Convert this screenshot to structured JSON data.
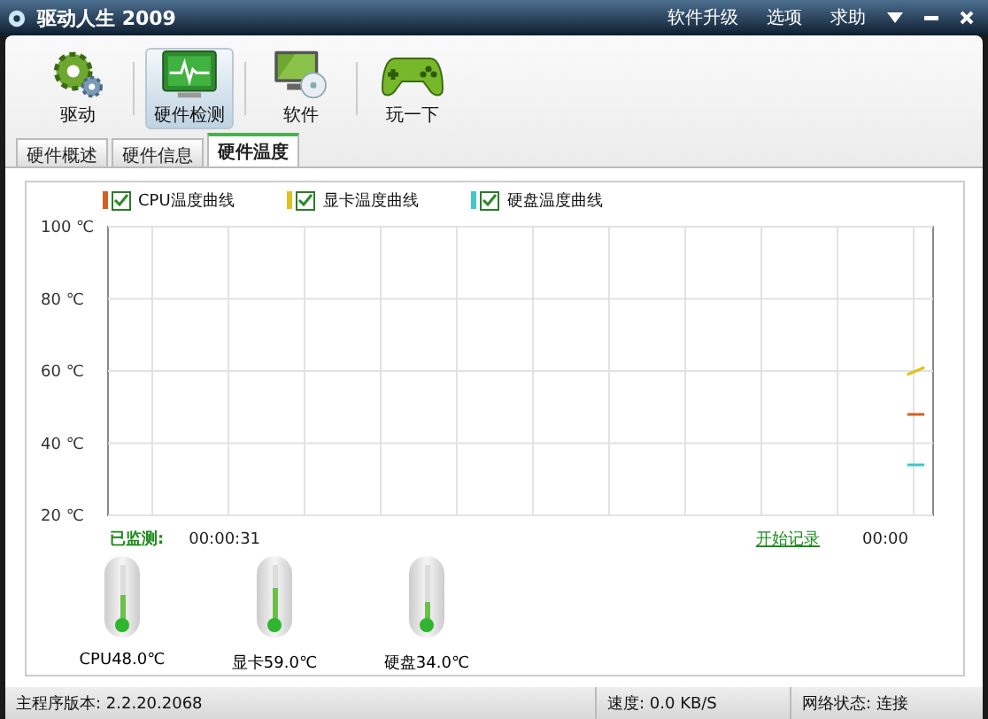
{
  "window": {
    "title": "驱动人生 2009",
    "menu": [
      "软件升级",
      "选项",
      "求助"
    ]
  },
  "toolbar": [
    {
      "label": "驱动",
      "selected": false
    },
    {
      "label": "硬件检测",
      "selected": true
    },
    {
      "label": "软件",
      "selected": false
    },
    {
      "label": "玩一下",
      "selected": false
    }
  ],
  "tabs": [
    {
      "label": "硬件概述",
      "selected": false
    },
    {
      "label": "硬件信息",
      "selected": false
    },
    {
      "label": "硬件温度",
      "selected": true
    }
  ],
  "legend": [
    {
      "checked": true
    },
    {
      "checked": true
    },
    {
      "checked": true
    }
  ],
  "chart_data": {
    "type": "line",
    "grid": true,
    "categories": [
      null,
      null,
      null,
      null,
      null,
      null,
      null,
      null,
      null,
      null,
      null,
      null,
      null,
      null,
      null,
      null,
      null,
      null,
      null,
      null,
      null,
      null,
      null,
      null,
      null,
      null,
      null,
      null,
      null,
      null,
      null,
      null,
      null,
      null,
      null,
      null,
      null,
      null,
      null,
      null,
      null,
      null,
      null,
      null,
      null,
      null,
      null,
      null
    ],
    "ylim": [
      20,
      100
    ],
    "yticks": [
      {
        "value": 20,
        "label": "20 ℃"
      },
      {
        "value": 40,
        "label": "40 ℃"
      },
      {
        "value": 60,
        "label": "60 ℃"
      },
      {
        "value": 80,
        "label": "80 ℃"
      },
      {
        "value": 100,
        "label": "100 ℃"
      }
    ],
    "series": [
      {
        "name": "CPU温度曲线",
        "color": "#d2601e",
        "values": [
          null,
          null,
          null,
          null,
          null,
          null,
          null,
          null,
          null,
          null,
          null,
          null,
          null,
          null,
          null,
          null,
          null,
          null,
          null,
          null,
          null,
          null,
          null,
          null,
          null,
          null,
          null,
          null,
          null,
          null,
          null,
          null,
          null,
          null,
          null,
          null,
          null,
          null,
          null,
          null,
          null,
          null,
          null,
          null,
          null,
          null,
          48,
          48
        ]
      },
      {
        "name": "显卡温度曲线",
        "color": "#e0c020",
        "values": [
          null,
          null,
          null,
          null,
          null,
          null,
          null,
          null,
          null,
          null,
          null,
          null,
          null,
          null,
          null,
          null,
          null,
          null,
          null,
          null,
          null,
          null,
          null,
          null,
          null,
          null,
          null,
          null,
          null,
          null,
          null,
          null,
          null,
          null,
          null,
          null,
          null,
          null,
          null,
          null,
          null,
          null,
          null,
          null,
          null,
          null,
          59,
          61
        ]
      },
      {
        "name": "硬盘温度曲线",
        "color": "#40c8c8",
        "values": [
          null,
          null,
          null,
          null,
          null,
          null,
          null,
          null,
          null,
          null,
          null,
          null,
          null,
          null,
          null,
          null,
          null,
          null,
          null,
          null,
          null,
          null,
          null,
          null,
          null,
          null,
          null,
          null,
          null,
          null,
          null,
          null,
          null,
          null,
          null,
          null,
          null,
          null,
          null,
          null,
          null,
          null,
          null,
          null,
          null,
          null,
          34,
          34
        ]
      }
    ]
  },
  "monitor": {
    "label": "已监测:",
    "elapsed": "00:00:31",
    "record_link": "开始记录",
    "record_time": "00:00"
  },
  "thermometers": [
    {
      "label": "CPU48.0℃",
      "level": 0.48
    },
    {
      "label": "显卡59.0℃",
      "level": 0.59
    },
    {
      "label": "硬盘34.0℃",
      "level": 0.34
    }
  ],
  "status_bar": [
    "主程序版本: 2.2.20.2068",
    "速度: 0.0 KB/S",
    "网络状态: 连接"
  ]
}
